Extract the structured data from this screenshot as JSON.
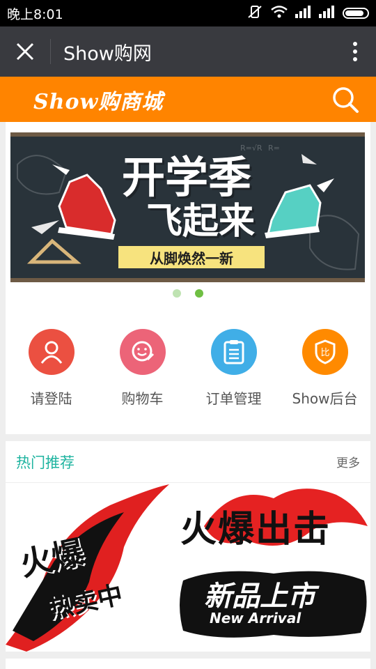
{
  "status_bar": {
    "time": "晚上8:01"
  },
  "title_bar": {
    "title": "Show购网"
  },
  "header": {
    "logo": "Show购商城"
  },
  "banner": {
    "title_line1": "开学季",
    "title_line2": "飞起来",
    "subtitle": "从脚焕然一新",
    "active_dot": 1
  },
  "quick_menu": [
    {
      "label": "请登陆",
      "icon": "user-icon",
      "color": "#eb5041"
    },
    {
      "label": "购物车",
      "icon": "smile-edit-icon",
      "color": "#ec6478"
    },
    {
      "label": "订单管理",
      "icon": "clipboard-icon",
      "color": "#40aee7"
    },
    {
      "label": "Show后台",
      "icon": "shield-icon",
      "color": "#ff8a00"
    }
  ],
  "hot_section": {
    "title": "热门推荐",
    "more": "更多",
    "promos": [
      {
        "line1": "火爆",
        "line2": "热卖中"
      },
      {
        "text": "火爆出击"
      },
      {
        "text": "新品上市",
        "sub": "New Arrival"
      }
    ]
  },
  "colors": {
    "accent": "#ff8400",
    "titlebar": "#393a3f",
    "teal": "#1fb4a0"
  }
}
